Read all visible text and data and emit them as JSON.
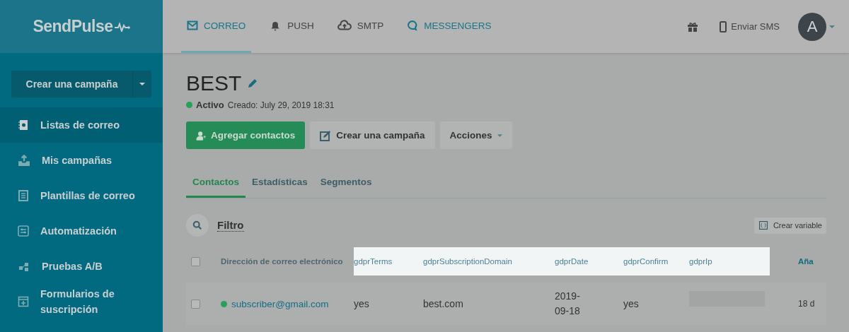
{
  "logo": "SendPulse",
  "nav": [
    {
      "label": "CORREO",
      "selected": true
    },
    {
      "label": "PUSH",
      "selected": false
    },
    {
      "label": "SMTP",
      "selected": false
    },
    {
      "label": "MESSENGERS",
      "selected": false
    }
  ],
  "top_right": {
    "sms": "Enviar SMS",
    "avatar": "A"
  },
  "sidebar": {
    "create_button": "Crear una campaña",
    "items": [
      {
        "label": "Listas de correo",
        "selected": true
      },
      {
        "label": "Mis campañas",
        "selected": false
      },
      {
        "label": "Plantillas de correo",
        "selected": false
      },
      {
        "label": "Automatización",
        "selected": false
      },
      {
        "label": "Pruebas A/B",
        "selected": false
      },
      {
        "label": "Formularios de suscripción",
        "selected": false
      }
    ]
  },
  "list": {
    "title": "BEST",
    "status": "Activo",
    "created": "Creado: July 29, 2019 18:31"
  },
  "actions": [
    {
      "label": "Agregar contactos",
      "kind": "primary"
    },
    {
      "label": "Crear una campaña",
      "kind": "edit"
    },
    {
      "label": "Acciones",
      "kind": "dropdown"
    }
  ],
  "tabs": [
    {
      "label": "Contactos",
      "selected": true
    },
    {
      "label": "Estadísticas",
      "selected": false
    },
    {
      "label": "Segmentos",
      "selected": false
    }
  ],
  "filter": "Filtro",
  "create_variable": "Crear variable",
  "table": {
    "select_all_checked": false,
    "columns": [
      {
        "label": "Dirección de correo electrónico",
        "highlighted": false
      },
      {
        "label": "gdprTerms",
        "highlighted": true
      },
      {
        "label": "gdprSubscriptionDomain",
        "highlighted": true
      },
      {
        "label": "gdprDate",
        "highlighted": true
      },
      {
        "label": "gdprConfirm",
        "highlighted": true
      },
      {
        "label": "gdprIp",
        "highlighted": true
      },
      {
        "label": "Aña",
        "highlighted": false
      }
    ],
    "rows": [
      {
        "checked": false,
        "color": "#27a15a",
        "cells": [
          {
            "kind": "email",
            "text": "subscriber@gmail.com"
          },
          {
            "kind": "text",
            "text": "yes"
          },
          {
            "kind": "text",
            "text": "best.com"
          },
          {
            "kind": "text",
            "text": "2019-09-18"
          },
          {
            "kind": "text",
            "text": "yes"
          },
          {
            "kind": "redacted"
          },
          {
            "kind": "text",
            "text": "18 d"
          }
        ]
      }
    ]
  }
}
